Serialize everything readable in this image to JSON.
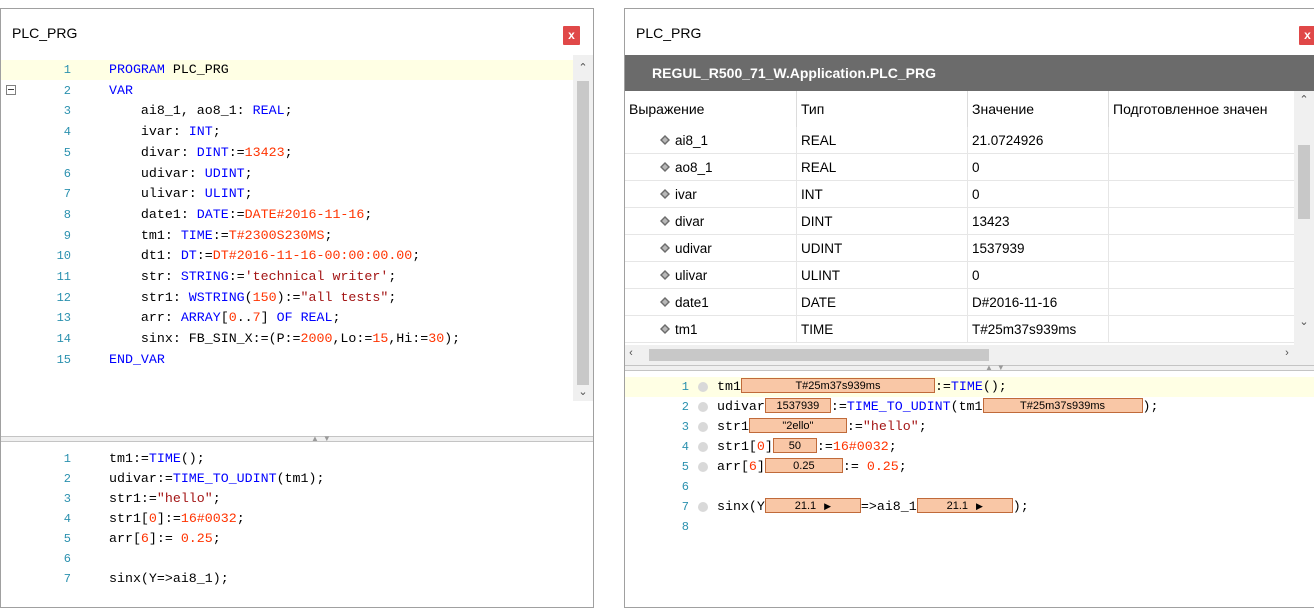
{
  "left": {
    "title": "PLC_PRG",
    "close_label": "x",
    "decl": [
      {
        "n": "1",
        "html": "<span class=\"kw\">PROGRAM</span> PLC_PRG"
      },
      {
        "n": "2",
        "html": "<span class=\"kw\">VAR</span>"
      },
      {
        "n": "3",
        "html": "    ai8_1, ao8_1: <span class=\"kw\">REAL</span>;"
      },
      {
        "n": "4",
        "html": "    ivar: <span class=\"kw\">INT</span>;"
      },
      {
        "n": "5",
        "html": "    divar: <span class=\"kw\">DINT</span>:=<span class=\"nm\">13423</span>;"
      },
      {
        "n": "6",
        "html": "    udivar: <span class=\"kw\">UDINT</span>;"
      },
      {
        "n": "7",
        "html": "    ulivar: <span class=\"kw\">ULINT</span>;"
      },
      {
        "n": "8",
        "html": "    date1: <span class=\"kw\">DATE</span>:=<span class=\"nm\">DATE#2016-11-16</span>;"
      },
      {
        "n": "9",
        "html": "    tm1: <span class=\"kw\">TIME</span>:=<span class=\"nm\">T#2300S230MS</span>;"
      },
      {
        "n": "10",
        "html": "    dt1: <span class=\"kw\">DT</span>:=<span class=\"nm\">DT#2016-11-16-00:00:00.00</span>;"
      },
      {
        "n": "11",
        "html": "    str: <span class=\"kw\">STRING</span>:=<span class=\"st\">'technical writer'</span>;"
      },
      {
        "n": "12",
        "html": "    str1: <span class=\"kw\">WSTRING</span>(<span class=\"nm\">150</span>):=<span class=\"st\">\"all tests\"</span>;"
      },
      {
        "n": "13",
        "html": "    arr: <span class=\"kw\">ARRAY</span>[<span class=\"nm\">0</span>..<span class=\"nm\">7</span>] <span class=\"kw\">OF REAL</span>;"
      },
      {
        "n": "14",
        "html": "    sinx: FB_SIN_X:=(P:=<span class=\"nm\">2000</span>,Lo:=<span class=\"nm\">15</span>,Hi:=<span class=\"nm\">30</span>);"
      },
      {
        "n": "15",
        "html": "<span class=\"kw\">END_VAR</span>"
      }
    ],
    "impl": [
      {
        "n": "1",
        "html": "tm1:=<span class=\"kw\">TIME</span>();"
      },
      {
        "n": "2",
        "html": "udivar:=<span class=\"kw\">TIME_TO_UDINT</span>(tm1);"
      },
      {
        "n": "3",
        "html": "str1:=<span class=\"st\">\"hello\"</span>;"
      },
      {
        "n": "4",
        "html": "str1[<span class=\"nm\">0</span>]:=<span class=\"nm\">16#0032</span>;"
      },
      {
        "n": "5",
        "html": "arr[<span class=\"nm\">6</span>]:= <span class=\"nm\">0.25</span>;"
      },
      {
        "n": "6",
        "html": ""
      },
      {
        "n": "7",
        "html": "sinx(Y=&gt;ai8_1);"
      }
    ]
  },
  "right": {
    "title": "PLC_PRG",
    "close_label": "x",
    "path": "REGUL_R500_71_W.Application.PLC_PRG",
    "headers": [
      "Выражение",
      "Тип",
      "Значение",
      "Подготовленное значен"
    ],
    "rows": [
      {
        "name": "ai8_1",
        "type": "REAL",
        "value": "21.0724926"
      },
      {
        "name": "ao8_1",
        "type": "REAL",
        "value": "0"
      },
      {
        "name": "ivar",
        "type": "INT",
        "value": "0"
      },
      {
        "name": "divar",
        "type": "DINT",
        "value": "13423"
      },
      {
        "name": "udivar",
        "type": "UDINT",
        "value": "1537939"
      },
      {
        "name": "ulivar",
        "type": "ULINT",
        "value": "0"
      },
      {
        "name": "date1",
        "type": "DATE",
        "value": "D#2016-11-16"
      },
      {
        "name": "tm1",
        "type": "TIME",
        "value": "T#25m37s939ms"
      }
    ],
    "online": [
      {
        "n": "1",
        "dot": true,
        "html": "tm1<span class=\"iv\" style=\"width:194px\">T#25m37s939ms</span>:=<span class=\"kw\">TIME</span>();"
      },
      {
        "n": "2",
        "dot": true,
        "html": "udivar<span class=\"iv\" style=\"width:66px\">1537939</span>:=<span class=\"kw\">TIME_TO_UDINT</span>(tm1<span class=\"iv\" style=\"width:160px\">T#25m37s939ms</span>);"
      },
      {
        "n": "3",
        "dot": true,
        "html": "str1<span class=\"iv\" style=\"width:98px\">\"2ello\"</span>:=<span class=\"st\">\"hello\"</span>;"
      },
      {
        "n": "4",
        "dot": true,
        "html": "str1[<span class=\"nm\">0</span>]<span class=\"iv\" style=\"width:44px\">50</span>:=<span class=\"nm\">16#0032</span>;"
      },
      {
        "n": "5",
        "dot": true,
        "html": "arr[<span class=\"nm\">6</span>]<span class=\"iv\" style=\"width:78px\">0.25</span>:= <span class=\"nm\">0.25</span>;"
      },
      {
        "n": "6",
        "dot": false,
        "html": ""
      },
      {
        "n": "7",
        "dot": true,
        "html": "sinx(Y<span class=\"iv\" style=\"width:96px\">21.1<span class=\"tri\">&#9654;</span></span>=&gt;ai8_1<span class=\"iv\" style=\"width:96px\">21.1<span class=\"tri\">&#9654;</span></span>);"
      },
      {
        "n": "8",
        "dot": false,
        "html": ""
      }
    ]
  }
}
